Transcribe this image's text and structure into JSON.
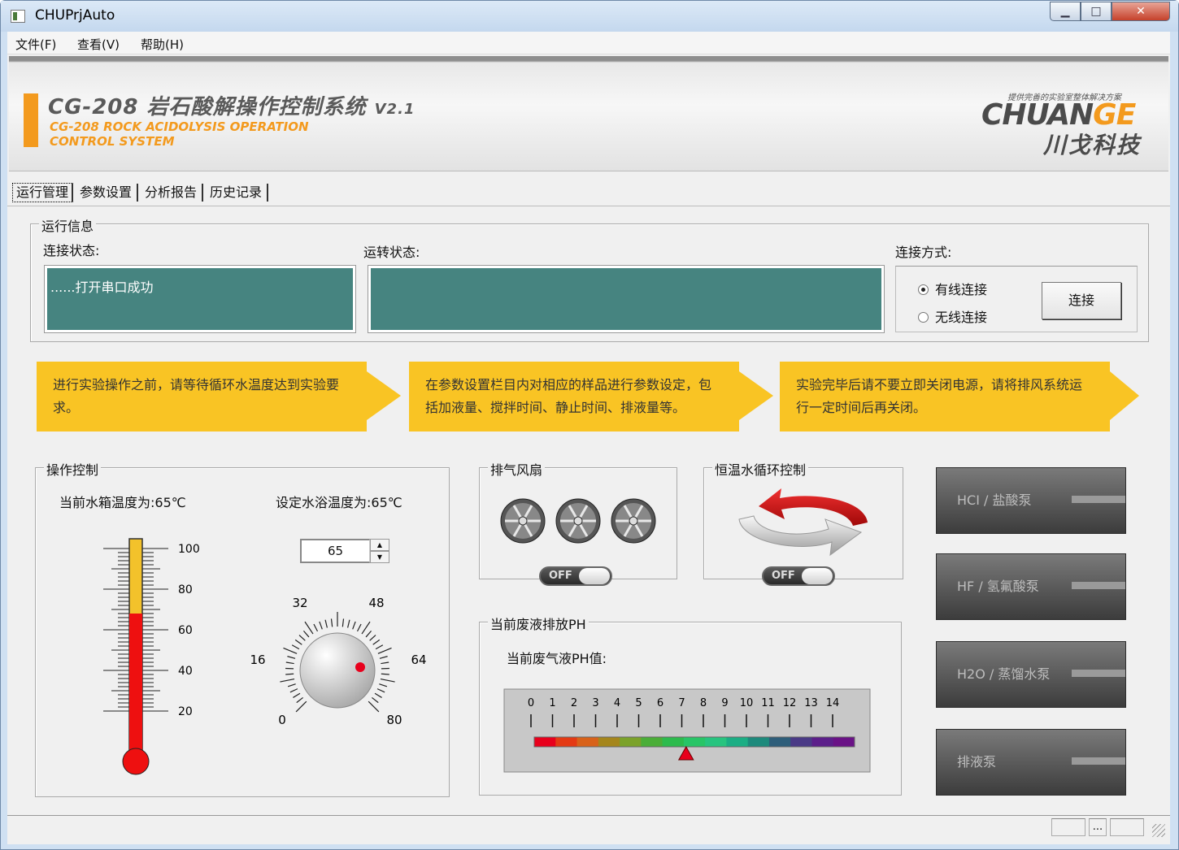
{
  "window": {
    "title": "CHUPrjAuto",
    "min_glyph": "▁",
    "max_glyph": "□",
    "close_glyph": "✕"
  },
  "menu": [
    "文件(F)",
    "查看(V)",
    "帮助(H)"
  ],
  "banner": {
    "title": "CG-208 岩石酸解操作控制系统",
    "version": "V2.1",
    "en_line1": "CG-208 ROCK ACIDOLYSIS OPERATION",
    "en_line2": "CONTROL SYSTEM",
    "slogan": "提供完善的实验室整体解决方案",
    "brand_a": "CHUAN",
    "brand_b": "GE",
    "brand_cn": "川戈科技",
    "accent_color": "#f39a1e"
  },
  "tabs": [
    "运行管理",
    "参数设置",
    "分析报告",
    "历史记录"
  ],
  "run_info": {
    "group_title": "运行信息",
    "conn_status_label": "连接状态:",
    "conn_status_value": "......打开串口成功",
    "run_status_label": "运转状态:",
    "run_status_value": "",
    "conn_mode_label": "连接方式:",
    "wired": "有线连接",
    "wireless": "无线连接",
    "connect_button": "连接"
  },
  "steps": [
    "进行实验操作之前，请等待循环水温度达到实验要求。",
    "在参数设置栏目内对相应的样品进行参数设定，包括加液量、搅拌时间、静止时间、排液量等。",
    "实验完毕后请不要立即关闭电源，请将排风系统运行一定时间后再关闭。"
  ],
  "control": {
    "group_title": "操作控制",
    "current_temp_label": "当前水箱温度为:65℃",
    "set_temp_label": "设定水浴温度为:65℃",
    "thermo_ticks": [
      "100",
      "80",
      "60",
      "40",
      "20"
    ],
    "thermo_level_fraction": 0.6,
    "spin_value": "65",
    "knob_labels": [
      "32",
      "48",
      "16",
      "64",
      "0",
      "80"
    ]
  },
  "fan": {
    "group_title": "排气风扇",
    "toggle": "OFF"
  },
  "water": {
    "group_title": "恒温水循环控制",
    "toggle": "OFF"
  },
  "ph": {
    "group_title": "当前废液排放PH",
    "label": "当前废气液PH值:",
    "ticks": [
      "0",
      "1",
      "2",
      "3",
      "4",
      "5",
      "6",
      "7",
      "8",
      "9",
      "10",
      "11",
      "12",
      "13",
      "14"
    ],
    "value": 7.2,
    "colors": [
      "#e8001c",
      "#e43a14",
      "#d8621a",
      "#a5861c",
      "#7ba22a",
      "#4bae38",
      "#2dbb4d",
      "#28c567",
      "#27c47f",
      "#1bae84",
      "#1d8a7c",
      "#2e5e7a",
      "#4a3a86",
      "#5c1f8a",
      "#6a1286"
    ]
  },
  "pumps": [
    "HCI / 盐酸泵",
    "HF / 氢氟酸泵",
    "H2O / 蒸馏水泵",
    "排液泵"
  ],
  "status": {
    "dots": "..."
  }
}
